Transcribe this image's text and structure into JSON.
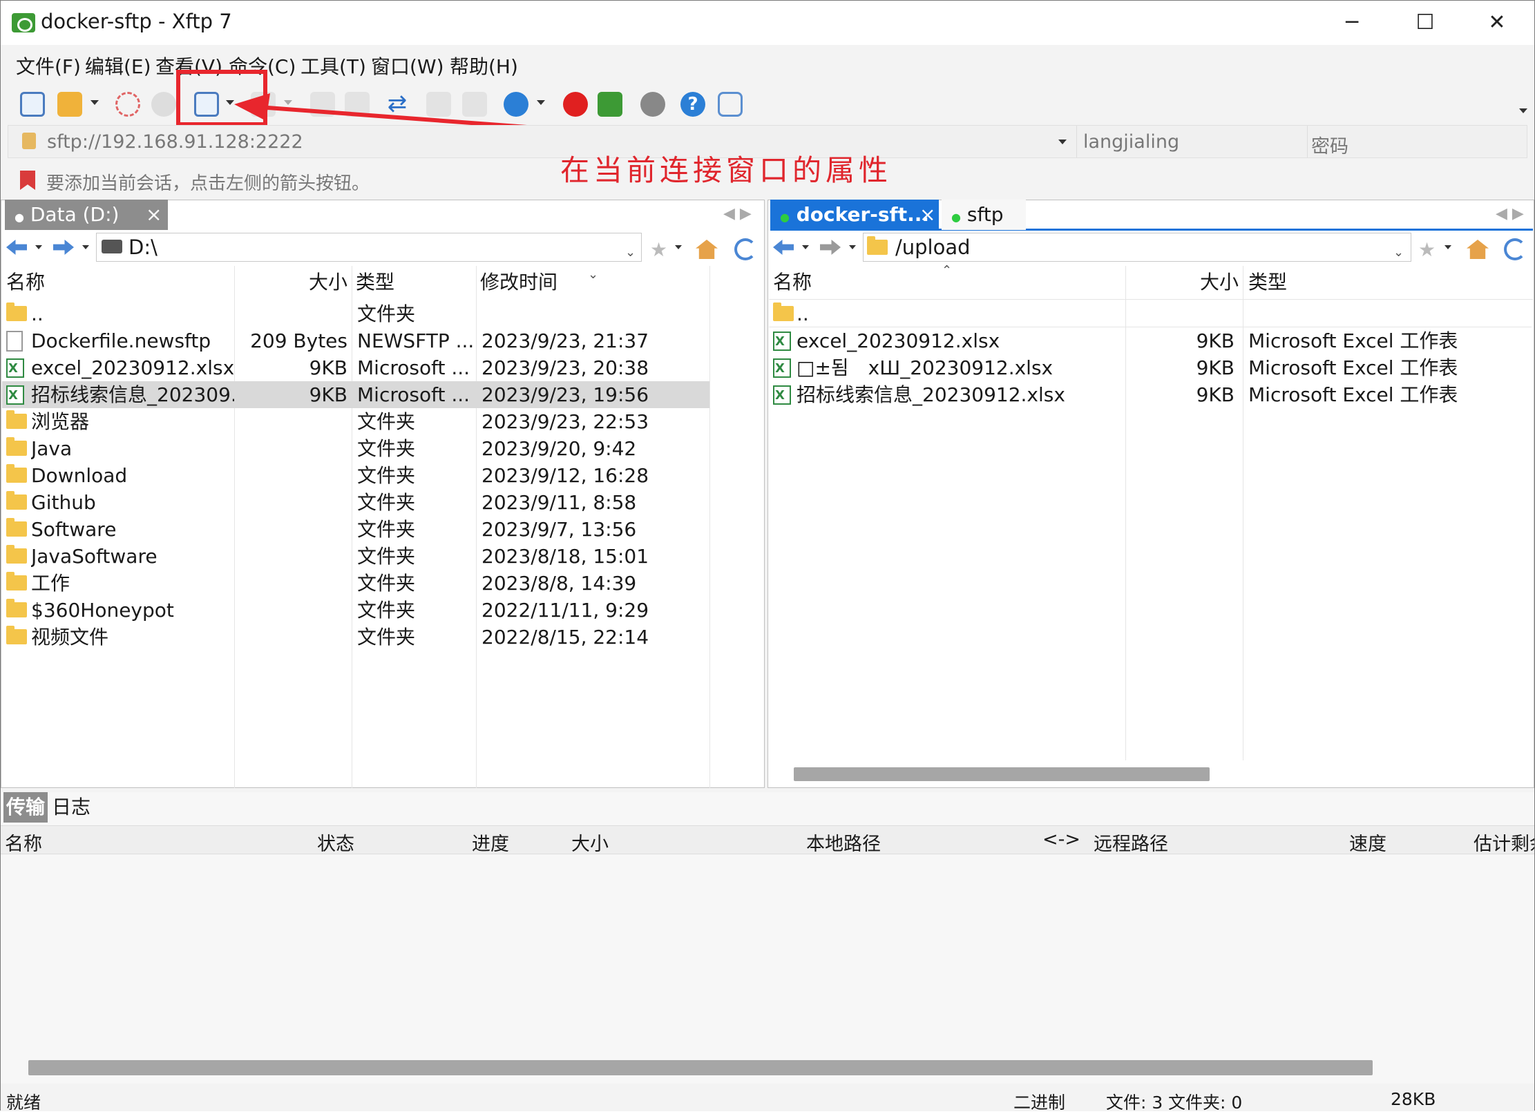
{
  "window": {
    "title": "docker-sftp - Xftp 7",
    "minimize": "─",
    "maximize": "☐",
    "close": "✕"
  },
  "menu": [
    "文件(F)",
    "编辑(E)",
    "查看(V)",
    "命令(C)",
    "工具(T)",
    "窗口(W)",
    "帮助(H)"
  ],
  "address": {
    "url": "sftp://192.168.91.128:2222",
    "username": "langjialing",
    "password_placeholder": "密码"
  },
  "hint": "要添加当前会话，点击左侧的箭头按钮。",
  "annotation": "在当前连接窗口的属性",
  "left": {
    "tab": "Data (D:)",
    "tab_close": "×",
    "path": "D:\\",
    "headers": [
      "名称",
      "大小",
      "类型",
      "修改时间"
    ],
    "rows": [
      {
        "icon": "folder",
        "name": "..",
        "size": "",
        "type": "文件夹",
        "date": ""
      },
      {
        "icon": "doc",
        "name": "Dockerfile.newsftp",
        "size": "209 Bytes",
        "type": "NEWSFTP ...",
        "date": "2023/9/23, 21:37"
      },
      {
        "icon": "xls",
        "name": "excel_20230912.xlsx",
        "size": "9KB",
        "type": "Microsoft ...",
        "date": "2023/9/23, 20:38"
      },
      {
        "icon": "xls",
        "name": "招标线索信息_202309...",
        "size": "9KB",
        "type": "Microsoft ...",
        "date": "2023/9/23, 19:56"
      },
      {
        "icon": "folder",
        "name": "浏览器",
        "size": "",
        "type": "文件夹",
        "date": "2023/9/23, 22:53"
      },
      {
        "icon": "folder",
        "name": "Java",
        "size": "",
        "type": "文件夹",
        "date": "2023/9/20, 9:42"
      },
      {
        "icon": "folder",
        "name": "Download",
        "size": "",
        "type": "文件夹",
        "date": "2023/9/12, 16:28"
      },
      {
        "icon": "folder",
        "name": "Github",
        "size": "",
        "type": "文件夹",
        "date": "2023/9/11, 8:58"
      },
      {
        "icon": "folder",
        "name": "Software",
        "size": "",
        "type": "文件夹",
        "date": "2023/9/7, 13:56"
      },
      {
        "icon": "folder",
        "name": "JavaSoftware",
        "size": "",
        "type": "文件夹",
        "date": "2023/8/18, 15:01"
      },
      {
        "icon": "folder",
        "name": "工作",
        "size": "",
        "type": "文件夹",
        "date": "2023/8/8, 14:39"
      },
      {
        "icon": "folder",
        "name": "$360Honeypot",
        "size": "",
        "type": "文件夹",
        "date": "2022/11/11, 9:29"
      },
      {
        "icon": "folder",
        "name": "视频文件",
        "size": "",
        "type": "文件夹",
        "date": "2022/8/15, 22:14"
      }
    ]
  },
  "right": {
    "tab1": "docker-sft...",
    "tab1_close": "×",
    "tab2": "sftp",
    "path": "/upload",
    "headers": [
      "名称",
      "大小",
      "类型"
    ],
    "rows": [
      {
        "icon": "folder",
        "name": "..",
        "size": "",
        "type": ""
      },
      {
        "icon": "xls",
        "name": "excel_20230912.xlsx",
        "size": "9KB",
        "type": "Microsoft Excel 工作表"
      },
      {
        "icon": "xls",
        "name": "□±됨　xШ_20230912.xlsx",
        "size": "9KB",
        "type": "Microsoft Excel 工作表"
      },
      {
        "icon": "xls",
        "name": "招标线索信息_20230912.xlsx",
        "size": "9KB",
        "type": "Microsoft Excel 工作表"
      }
    ]
  },
  "transfer": {
    "tabs": [
      "传输",
      "日志"
    ],
    "headers": [
      "名称",
      "状态",
      "进度",
      "大小",
      "本地路径",
      "<->",
      "远程路径",
      "速度",
      "估计剩余"
    ]
  },
  "status": {
    "ready": "就绪",
    "mode": "二进制",
    "files": "文件: 3",
    "folders": "文件夹: 0",
    "size": "28KB"
  }
}
